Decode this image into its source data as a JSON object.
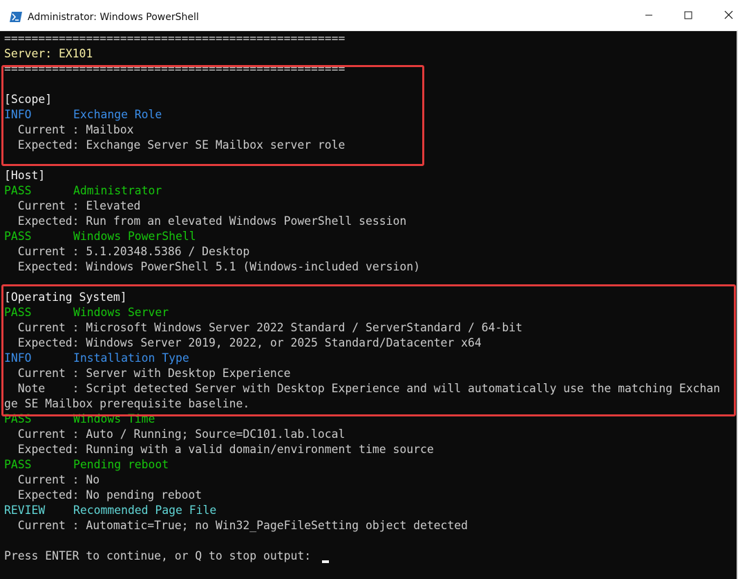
{
  "window": {
    "title": "Administrator: Windows PowerShell"
  },
  "icons": {
    "app": "powershell-icon",
    "minimize": "minimize-icon",
    "maximize": "maximize-icon",
    "close": "close-icon"
  },
  "colors": {
    "console_background": "#0c0c0c",
    "pass": "#16c60c",
    "info": "#3b8eea",
    "review": "#61d6d6",
    "server_header": "#f9f1a5",
    "highlight_box": "#e23b3b"
  },
  "console": {
    "separator": "==================================================",
    "server_line": "Server: EX101",
    "sections": {
      "scope": "[Scope]",
      "host": "[Host]",
      "os": "[Operating System]"
    },
    "checks": {
      "exchange_role": {
        "status": "INFO",
        "name": "Exchange Role",
        "current": "  Current : Mailbox",
        "expected": "  Expected: Exchange Server SE Mailbox server role"
      },
      "administrator": {
        "status": "PASS",
        "name": "Administrator",
        "current": "  Current : Elevated",
        "expected": "  Expected: Run from an elevated Windows PowerShell session"
      },
      "windows_powershell": {
        "status": "PASS",
        "name": "Windows PowerShell",
        "current": "  Current : 5.1.20348.5386 / Desktop",
        "expected": "  Expected: Windows PowerShell 5.1 (Windows-included version)"
      },
      "windows_server": {
        "status": "PASS",
        "name": "Windows Server",
        "current": "  Current : Microsoft Windows Server 2022 Standard / ServerStandard / 64-bit",
        "expected": "  Expected: Windows Server 2019, 2022, or 2025 Standard/Datacenter x64"
      },
      "installation_type": {
        "status": "INFO",
        "name": "Installation Type",
        "current": "  Current : Server with Desktop Experience",
        "note_1": "  Note    : Script detected Server with Desktop Experience and will automatically use the matching Exchan",
        "note_2": "ge SE Mailbox prerequisite baseline."
      },
      "windows_time": {
        "status": "PASS",
        "name": "Windows Time",
        "current": "  Current : Auto / Running; Source=DC101.lab.local",
        "expected": "  Expected: Running with a valid domain/environment time source"
      },
      "pending_reboot": {
        "status": "PASS",
        "name": "Pending reboot",
        "current": "  Current : No",
        "expected": "  Expected: No pending reboot"
      },
      "page_file": {
        "status": "REVIEW",
        "name": "Recommended Page File",
        "current": "  Current : Automatic=True; no Win32_PageFileSetting object detected"
      }
    },
    "prompt": "Press ENTER to continue, or Q to stop output: "
  }
}
